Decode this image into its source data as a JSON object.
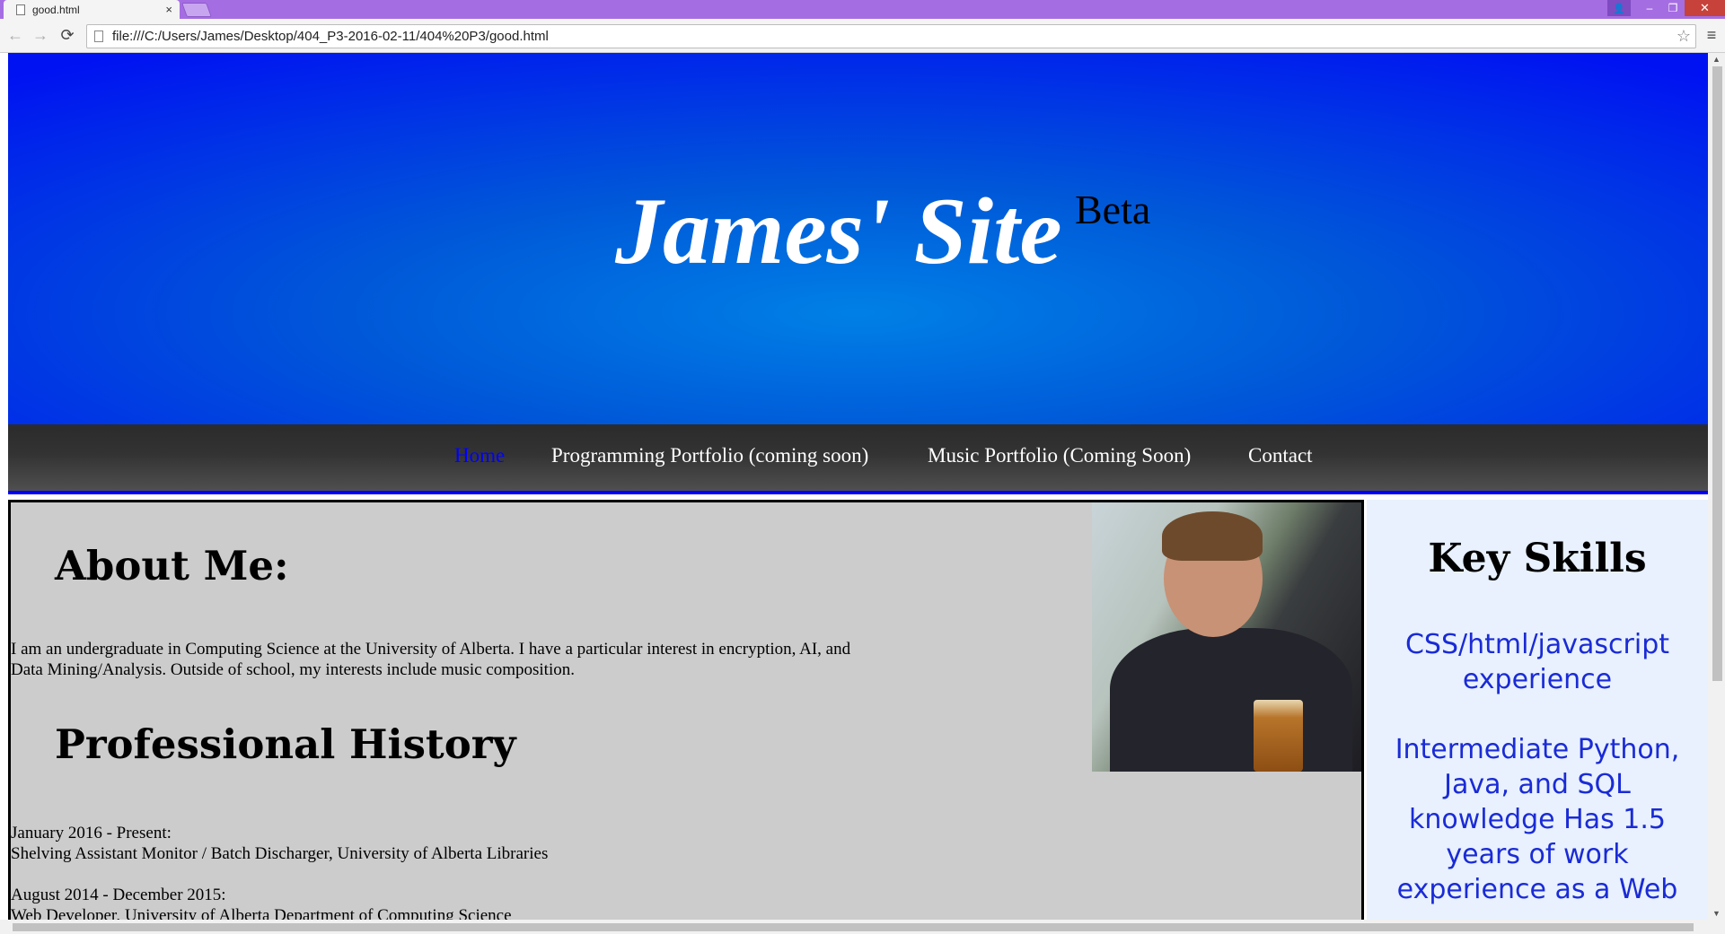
{
  "browser": {
    "tab_title": "good.html",
    "tab_close": "×",
    "url": "file:///C:/Users/James/Desktop/404_P3-2016-02-11/404%20P3/good.html",
    "back_glyph": "←",
    "forward_glyph": "→",
    "reload_glyph": "⟳",
    "star_glyph": "☆",
    "menu_glyph": "≡",
    "minimize_glyph": "–",
    "restore_glyph": "❐",
    "close_glyph": "✕",
    "profile_glyph": "👤"
  },
  "icons": {
    "tab": "page-icon",
    "url": "document-icon",
    "bookmark": "star-icon",
    "menu": "hamburger-icon",
    "profile": "person-icon"
  },
  "hero": {
    "title": "James' Site",
    "superscript": "Beta"
  },
  "nav": {
    "items": [
      {
        "label": "Home",
        "active": true
      },
      {
        "label": "Programming Portfolio (coming soon)",
        "active": false
      },
      {
        "label": "Music Portfolio (Coming Soon)",
        "active": false
      },
      {
        "label": "Contact",
        "active": false
      }
    ]
  },
  "main": {
    "about_heading": "About Me:",
    "about_line1": "I am an undergraduate in Computing Science at the University of Alberta. I have a particular interest in encryption, AI, and",
    "about_line2": "Data Mining/Analysis. Outside of school, my interests include music composition.",
    "history_heading": "Professional History",
    "history": [
      {
        "period": "January 2016 - Present:",
        "role": "Shelving Assistant Monitor / Batch Discharger, University of Alberta Libraries"
      },
      {
        "period": "August 2014 - December 2015:",
        "role": "Web Developer, University of Alberta Department of Computing Science"
      }
    ]
  },
  "sidebar": {
    "heading": "Key Skills",
    "skills": [
      "CSS/html/javascript experience",
      "Intermediate Python, Java, and SQL knowledge Has 1.5 years of work experience as a Web"
    ]
  },
  "colors": {
    "titlebar": "#a56de2",
    "hero_blue": "#0012f2",
    "nav_active": "#0000ff",
    "nav_bg": "#333333",
    "main_bg": "#cccccc",
    "sidebar_bg": "#e8f1fd",
    "skill_text": "#1a2bd6"
  }
}
